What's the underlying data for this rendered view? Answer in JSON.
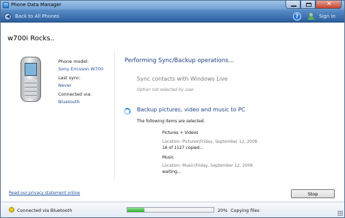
{
  "window": {
    "title": "Phone Data Manager"
  },
  "nav": {
    "back_label": "Back to All Phones",
    "signin_label": "Sign in"
  },
  "device": {
    "name": "w700i Rocks..",
    "model_label": "Phone model:",
    "model_value": "Sony Ericsson W700",
    "last_sync_label": "Last sync:",
    "last_sync_value": "Never",
    "connected_label": "Connected via:",
    "connected_value": "Bluetooth"
  },
  "operations": {
    "title": "Performing Sync/Backup operations...",
    "sync_contacts": {
      "title": "Sync contacts with Windows Live",
      "subtitle": "Option not selected by user"
    },
    "backup": {
      "title": "Backup pictures, video and music to PC",
      "subtitle": "The following items are selected.",
      "items": [
        {
          "name": "Pictures + Videos",
          "location": "Location:  Pictures\\Friday, September 12, 2008",
          "status": "16 of 1127 copied..."
        },
        {
          "name": "Music",
          "location": "Location:  Music\\Friday, September 12, 2008",
          "status": "waiting..."
        }
      ]
    }
  },
  "footer": {
    "privacy_link": "Read our privacy statement online",
    "stop_label": "Stop"
  },
  "statusbar": {
    "connection_text": "Connected via Bluetooth",
    "progress_fraction": 0.2,
    "progress_text": "20%",
    "progress_label": "Copying files"
  }
}
